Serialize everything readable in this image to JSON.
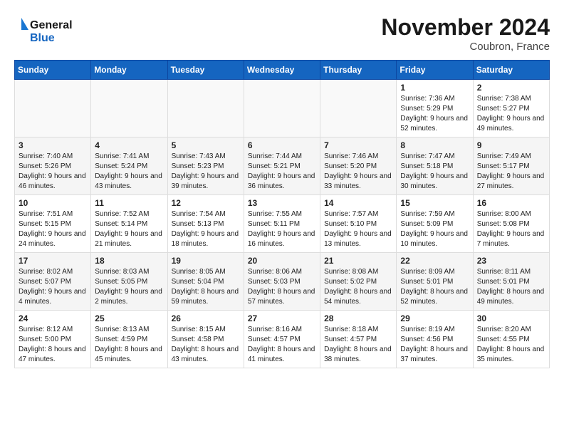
{
  "header": {
    "logo_text_general": "General",
    "logo_text_blue": "Blue",
    "month_title": "November 2024",
    "location": "Coubron, France"
  },
  "weekdays": [
    "Sunday",
    "Monday",
    "Tuesday",
    "Wednesday",
    "Thursday",
    "Friday",
    "Saturday"
  ],
  "weeks": [
    [
      {
        "day": "",
        "info": ""
      },
      {
        "day": "",
        "info": ""
      },
      {
        "day": "",
        "info": ""
      },
      {
        "day": "",
        "info": ""
      },
      {
        "day": "",
        "info": ""
      },
      {
        "day": "1",
        "info": "Sunrise: 7:36 AM\nSunset: 5:29 PM\nDaylight: 9 hours\nand 52 minutes."
      },
      {
        "day": "2",
        "info": "Sunrise: 7:38 AM\nSunset: 5:27 PM\nDaylight: 9 hours\nand 49 minutes."
      }
    ],
    [
      {
        "day": "3",
        "info": "Sunrise: 7:40 AM\nSunset: 5:26 PM\nDaylight: 9 hours\nand 46 minutes."
      },
      {
        "day": "4",
        "info": "Sunrise: 7:41 AM\nSunset: 5:24 PM\nDaylight: 9 hours\nand 43 minutes."
      },
      {
        "day": "5",
        "info": "Sunrise: 7:43 AM\nSunset: 5:23 PM\nDaylight: 9 hours\nand 39 minutes."
      },
      {
        "day": "6",
        "info": "Sunrise: 7:44 AM\nSunset: 5:21 PM\nDaylight: 9 hours\nand 36 minutes."
      },
      {
        "day": "7",
        "info": "Sunrise: 7:46 AM\nSunset: 5:20 PM\nDaylight: 9 hours\nand 33 minutes."
      },
      {
        "day": "8",
        "info": "Sunrise: 7:47 AM\nSunset: 5:18 PM\nDaylight: 9 hours\nand 30 minutes."
      },
      {
        "day": "9",
        "info": "Sunrise: 7:49 AM\nSunset: 5:17 PM\nDaylight: 9 hours\nand 27 minutes."
      }
    ],
    [
      {
        "day": "10",
        "info": "Sunrise: 7:51 AM\nSunset: 5:15 PM\nDaylight: 9 hours\nand 24 minutes."
      },
      {
        "day": "11",
        "info": "Sunrise: 7:52 AM\nSunset: 5:14 PM\nDaylight: 9 hours\nand 21 minutes."
      },
      {
        "day": "12",
        "info": "Sunrise: 7:54 AM\nSunset: 5:13 PM\nDaylight: 9 hours\nand 18 minutes."
      },
      {
        "day": "13",
        "info": "Sunrise: 7:55 AM\nSunset: 5:11 PM\nDaylight: 9 hours\nand 16 minutes."
      },
      {
        "day": "14",
        "info": "Sunrise: 7:57 AM\nSunset: 5:10 PM\nDaylight: 9 hours\nand 13 minutes."
      },
      {
        "day": "15",
        "info": "Sunrise: 7:59 AM\nSunset: 5:09 PM\nDaylight: 9 hours\nand 10 minutes."
      },
      {
        "day": "16",
        "info": "Sunrise: 8:00 AM\nSunset: 5:08 PM\nDaylight: 9 hours\nand 7 minutes."
      }
    ],
    [
      {
        "day": "17",
        "info": "Sunrise: 8:02 AM\nSunset: 5:07 PM\nDaylight: 9 hours\nand 4 minutes."
      },
      {
        "day": "18",
        "info": "Sunrise: 8:03 AM\nSunset: 5:05 PM\nDaylight: 9 hours\nand 2 minutes."
      },
      {
        "day": "19",
        "info": "Sunrise: 8:05 AM\nSunset: 5:04 PM\nDaylight: 8 hours\nand 59 minutes."
      },
      {
        "day": "20",
        "info": "Sunrise: 8:06 AM\nSunset: 5:03 PM\nDaylight: 8 hours\nand 57 minutes."
      },
      {
        "day": "21",
        "info": "Sunrise: 8:08 AM\nSunset: 5:02 PM\nDaylight: 8 hours\nand 54 minutes."
      },
      {
        "day": "22",
        "info": "Sunrise: 8:09 AM\nSunset: 5:01 PM\nDaylight: 8 hours\nand 52 minutes."
      },
      {
        "day": "23",
        "info": "Sunrise: 8:11 AM\nSunset: 5:01 PM\nDaylight: 8 hours\nand 49 minutes."
      }
    ],
    [
      {
        "day": "24",
        "info": "Sunrise: 8:12 AM\nSunset: 5:00 PM\nDaylight: 8 hours\nand 47 minutes."
      },
      {
        "day": "25",
        "info": "Sunrise: 8:13 AM\nSunset: 4:59 PM\nDaylight: 8 hours\nand 45 minutes."
      },
      {
        "day": "26",
        "info": "Sunrise: 8:15 AM\nSunset: 4:58 PM\nDaylight: 8 hours\nand 43 minutes."
      },
      {
        "day": "27",
        "info": "Sunrise: 8:16 AM\nSunset: 4:57 PM\nDaylight: 8 hours\nand 41 minutes."
      },
      {
        "day": "28",
        "info": "Sunrise: 8:18 AM\nSunset: 4:57 PM\nDaylight: 8 hours\nand 38 minutes."
      },
      {
        "day": "29",
        "info": "Sunrise: 8:19 AM\nSunset: 4:56 PM\nDaylight: 8 hours\nand 37 minutes."
      },
      {
        "day": "30",
        "info": "Sunrise: 8:20 AM\nSunset: 4:55 PM\nDaylight: 8 hours\nand 35 minutes."
      }
    ]
  ]
}
